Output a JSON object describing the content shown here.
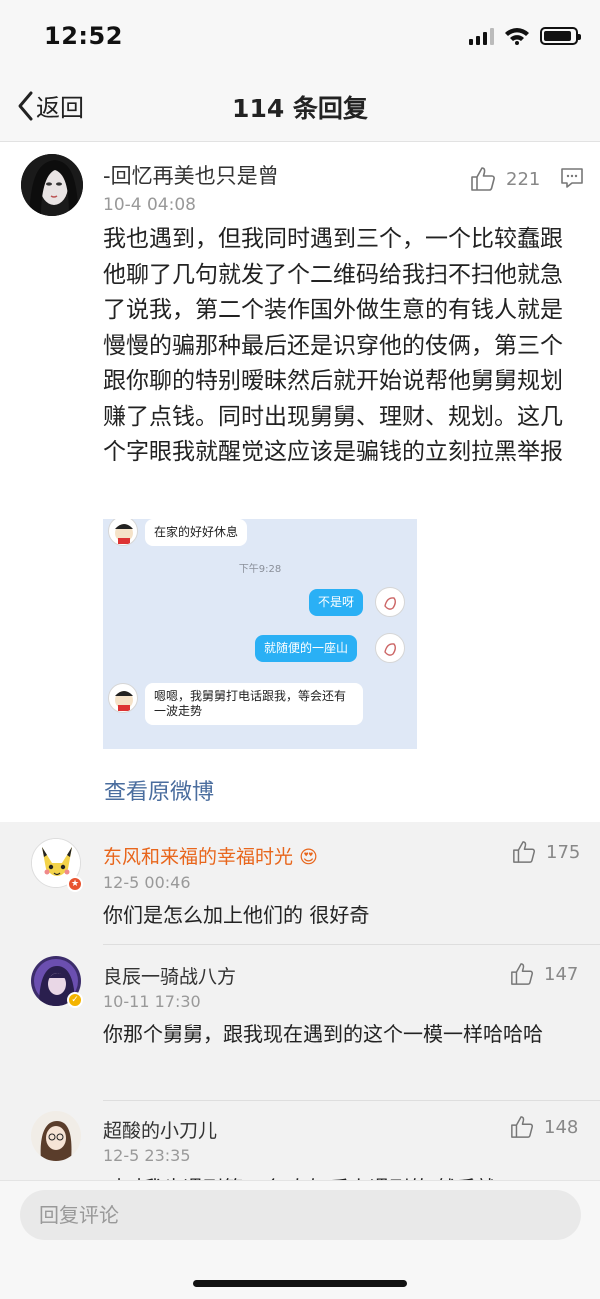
{
  "status_bar": {
    "time": "12:52",
    "icons": [
      "signal-icon",
      "wifi-icon",
      "battery-icon"
    ],
    "signal_bars": 4,
    "signal_active_bars": 3,
    "battery_level": 0.9
  },
  "nav": {
    "back_label": "返回",
    "title": "114 条回复",
    "back_icon": "chevron-left-icon"
  },
  "main_comment": {
    "author": "-回忆再美也只是曾",
    "time": "10-4 04:08",
    "likes": "221",
    "body": "我也遇到，但我同时遇到三个，一个比较蠢跟他聊了几句就发了个二维码给我扫不扫他就急了说我，第二个装作国外做生意的有钱人就是慢慢的骗那种最后还是识穿他的伎俩，第三个跟你聊的特别暧昧然后就开始说帮他舅舅规划赚了点钱。同时出现舅舅、理财、规划。这几个字眼我就醒觉这应该是骗钱的立刻拉黑举报",
    "view_original": "查看原微博",
    "embedded_chat": {
      "messages": [
        {
          "side": "left",
          "text": "在家的好好休息"
        },
        {
          "side": "time",
          "text": "下午9:28"
        },
        {
          "side": "right",
          "text": "不是呀"
        },
        {
          "side": "right",
          "text": "就随便的一座山"
        },
        {
          "side": "left",
          "text": "嗯嗯，我舅舅打电话跟我，等会还有一波走势"
        }
      ]
    }
  },
  "replies": [
    {
      "name": "东风和来福的幸福时光",
      "name_color": "#e8661c",
      "emoji": "😍",
      "time": "12-5 00:46",
      "likes": "175",
      "text": "你们是怎么加上他们的 很好奇"
    },
    {
      "name": "良辰一骑战八方",
      "name_color": "#333333",
      "time": "10-11 17:30",
      "likes": "147",
      "text": "你那个舅舅，跟我现在遇到的这个一模一样哈哈哈"
    },
    {
      "name": "超酸的小刀儿",
      "name_color": "#333333",
      "time": "12-5 23:35",
      "likes": "148",
      "text": "对对我也遇到第三个 左知乎上遇到的 然后就"
    }
  ],
  "bottom": {
    "input_placeholder": "回复评论"
  },
  "colors": {
    "accent_link": "#4a6d9e",
    "chat_bubble_blue": "#2ab0f5",
    "reply_bg": "#f2f2f2",
    "highlight_name": "#e8661c"
  }
}
